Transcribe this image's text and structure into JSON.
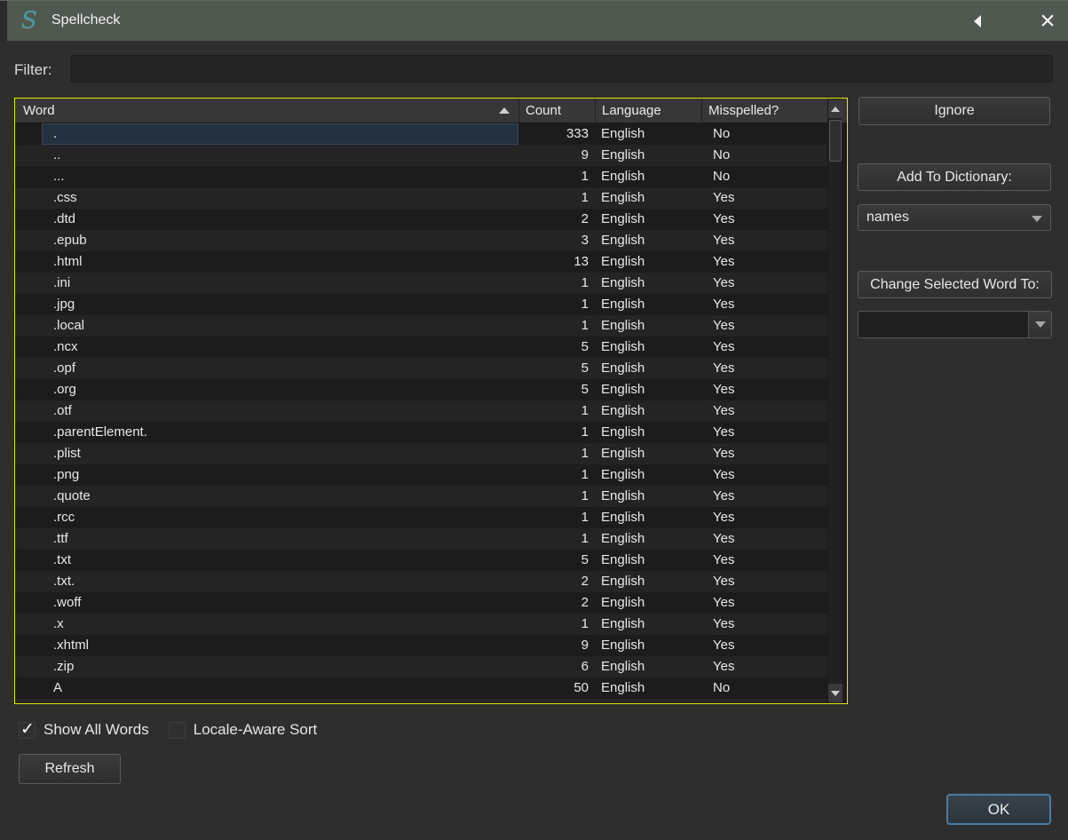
{
  "window": {
    "title": "Spellcheck",
    "logo_letter": "S",
    "collapse_icon": "left-triangle",
    "close_icon": "x"
  },
  "filter": {
    "label": "Filter:",
    "value": "",
    "placeholder": ""
  },
  "table": {
    "columns": {
      "word": "Word",
      "count": "Count",
      "language": "Language",
      "misspelled": "Misspelled?"
    },
    "sort": {
      "column": "Word",
      "direction": "ascending"
    },
    "selected_row": 0,
    "rows": [
      {
        "word": ".",
        "count": 333,
        "language": "English",
        "misspelled": "No"
      },
      {
        "word": "..",
        "count": 9,
        "language": "English",
        "misspelled": "No"
      },
      {
        "word": "...",
        "count": 1,
        "language": "English",
        "misspelled": "No"
      },
      {
        "word": ".css",
        "count": 1,
        "language": "English",
        "misspelled": "Yes"
      },
      {
        "word": ".dtd",
        "count": 2,
        "language": "English",
        "misspelled": "Yes"
      },
      {
        "word": ".epub",
        "count": 3,
        "language": "English",
        "misspelled": "Yes"
      },
      {
        "word": ".html",
        "count": 13,
        "language": "English",
        "misspelled": "Yes"
      },
      {
        "word": ".ini",
        "count": 1,
        "language": "English",
        "misspelled": "Yes"
      },
      {
        "word": ".jpg",
        "count": 1,
        "language": "English",
        "misspelled": "Yes"
      },
      {
        "word": ".local",
        "count": 1,
        "language": "English",
        "misspelled": "Yes"
      },
      {
        "word": ".ncx",
        "count": 5,
        "language": "English",
        "misspelled": "Yes"
      },
      {
        "word": ".opf",
        "count": 5,
        "language": "English",
        "misspelled": "Yes"
      },
      {
        "word": ".org",
        "count": 5,
        "language": "English",
        "misspelled": "Yes"
      },
      {
        "word": ".otf",
        "count": 1,
        "language": "English",
        "misspelled": "Yes"
      },
      {
        "word": ".parentElement.",
        "count": 1,
        "language": "English",
        "misspelled": "Yes"
      },
      {
        "word": ".plist",
        "count": 1,
        "language": "English",
        "misspelled": "Yes"
      },
      {
        "word": ".png",
        "count": 1,
        "language": "English",
        "misspelled": "Yes"
      },
      {
        "word": ".quote",
        "count": 1,
        "language": "English",
        "misspelled": "Yes"
      },
      {
        "word": ".rcc",
        "count": 1,
        "language": "English",
        "misspelled": "Yes"
      },
      {
        "word": ".ttf",
        "count": 1,
        "language": "English",
        "misspelled": "Yes"
      },
      {
        "word": ".txt",
        "count": 5,
        "language": "English",
        "misspelled": "Yes"
      },
      {
        "word": ".txt.",
        "count": 2,
        "language": "English",
        "misspelled": "Yes"
      },
      {
        "word": ".woff",
        "count": 2,
        "language": "English",
        "misspelled": "Yes"
      },
      {
        "word": ".x",
        "count": 1,
        "language": "English",
        "misspelled": "Yes"
      },
      {
        "word": ".xhtml",
        "count": 9,
        "language": "English",
        "misspelled": "Yes"
      },
      {
        "word": ".zip",
        "count": 6,
        "language": "English",
        "misspelled": "Yes"
      },
      {
        "word": "A",
        "count": 50,
        "language": "English",
        "misspelled": "No"
      }
    ]
  },
  "actions": {
    "ignore_label": "Ignore",
    "add_to_dictionary_label": "Add To Dictionary:",
    "dictionary_selected": "names",
    "change_selected_label": "Change Selected Word To:",
    "change_value": ""
  },
  "footer": {
    "show_all_words_label": "Show All Words",
    "show_all_words_checked": true,
    "locale_aware_label": "Locale-Aware Sort",
    "locale_aware_checked": false,
    "refresh_label": "Refresh",
    "ok_label": "OK"
  },
  "colors": {
    "titlebar": "#4f594f",
    "accent": "#e6e600",
    "selection": "#24323f",
    "logo": "#4a99a3",
    "ok-border": "#4b7ca4"
  }
}
